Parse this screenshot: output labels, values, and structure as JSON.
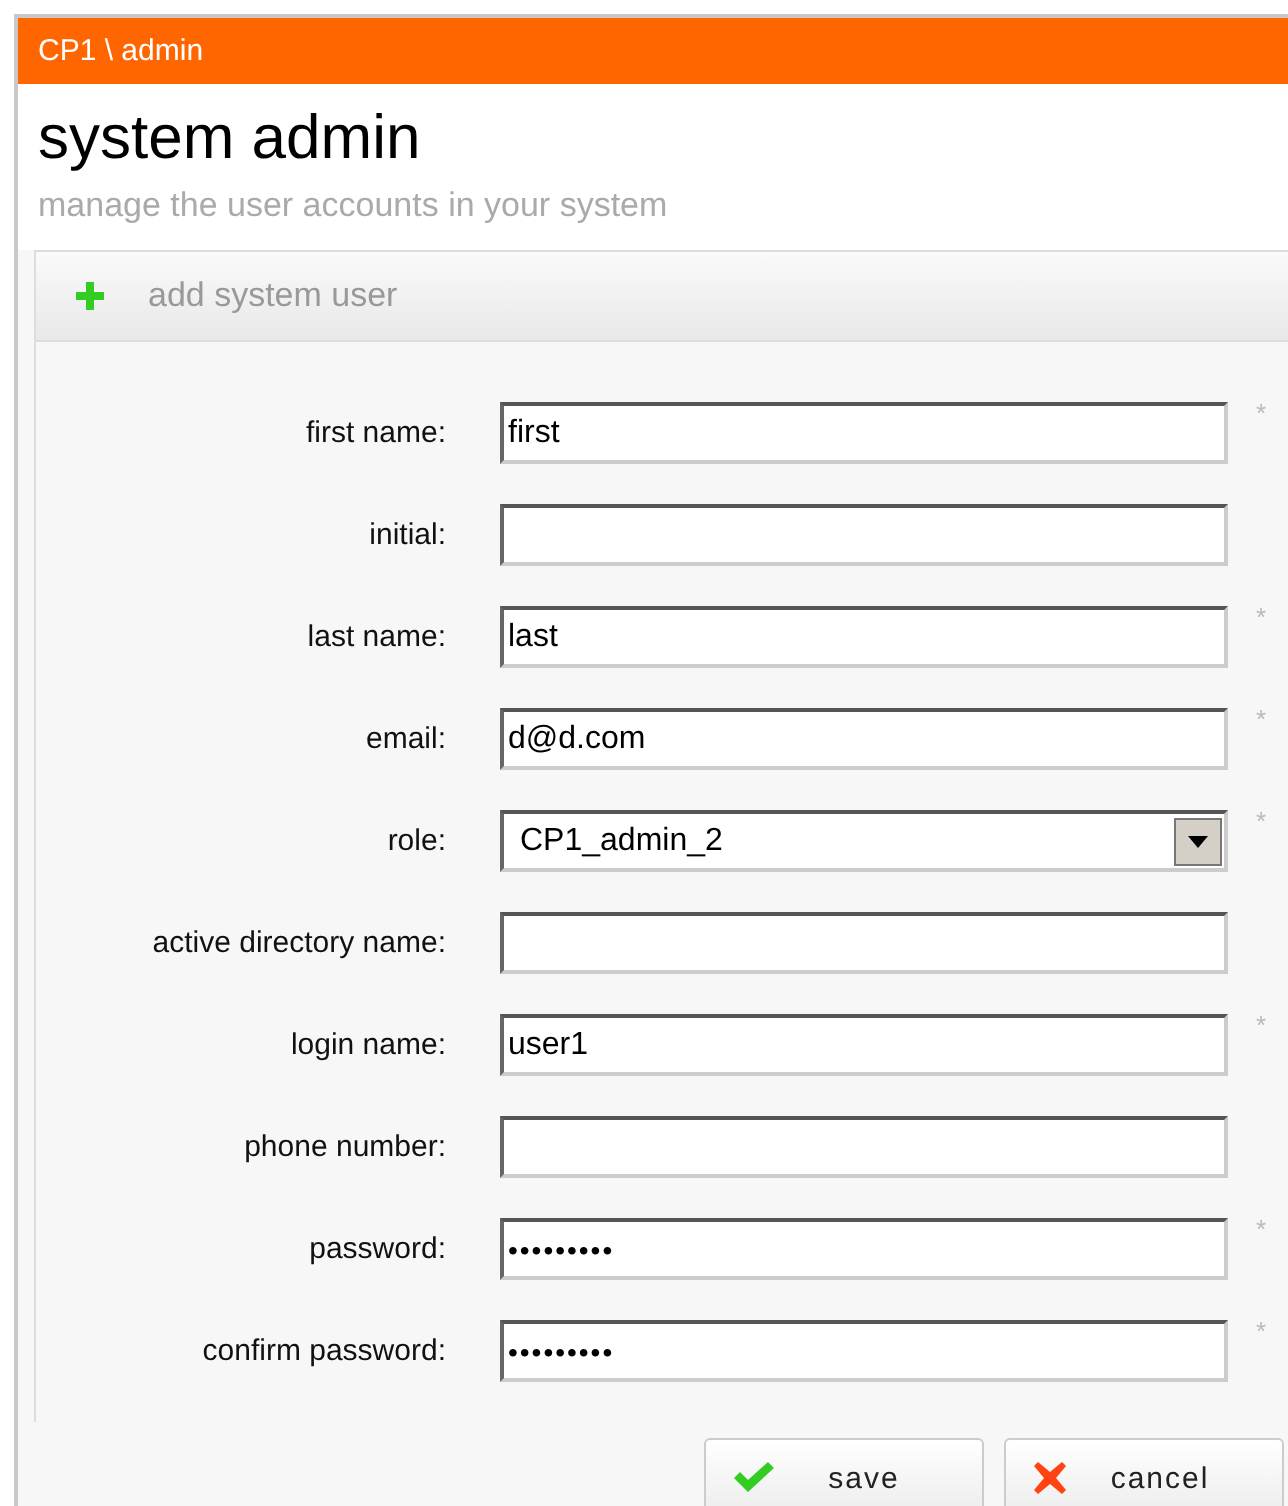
{
  "breadcrumb": "CP1 \\ admin",
  "title": "system admin",
  "subtitle": "manage the user accounts in your system",
  "section": {
    "label": "add system user"
  },
  "fields": [
    {
      "label": "first name:",
      "kind": "text",
      "value": "first",
      "required": true
    },
    {
      "label": "initial:",
      "kind": "text",
      "required": false
    },
    {
      "label": "last name:",
      "kind": "text",
      "value": "last",
      "required": true
    },
    {
      "label": "email:",
      "kind": "text",
      "value": "d@d.com",
      "required": true
    },
    {
      "label": "role:",
      "kind": "select",
      "value": "CP1_admin_2",
      "required": true
    },
    {
      "label": "active directory name:",
      "kind": "text",
      "required": false
    },
    {
      "label": "login name:",
      "kind": "text",
      "value": "user1",
      "required": true
    },
    {
      "label": "phone number:",
      "kind": "text",
      "required": false
    },
    {
      "label": "password:",
      "kind": "password",
      "value": "•••••••••",
      "required": true
    },
    {
      "label": "confirm password:",
      "kind": "password",
      "value": "•••••••••",
      "required": true
    }
  ],
  "required_mark": "*",
  "buttons": [
    {
      "label": "save",
      "kind": "save"
    },
    {
      "label": "cancel",
      "kind": "cancel"
    }
  ]
}
